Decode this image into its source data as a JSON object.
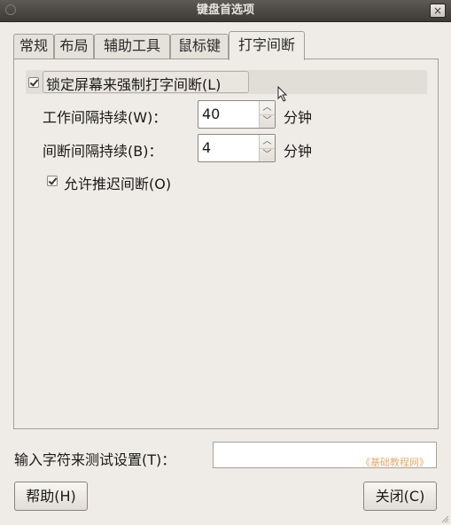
{
  "window": {
    "title": "键盘首选项",
    "close_glyph": "×"
  },
  "tabs": [
    {
      "label": "常规",
      "active": false
    },
    {
      "label": "布局",
      "active": false
    },
    {
      "label": "辅助工具",
      "active": false
    },
    {
      "label": "鼠标键",
      "active": false
    },
    {
      "label": "打字间断",
      "active": true
    }
  ],
  "typing_break": {
    "lock_screen": {
      "label": "锁定屏幕来强制打字间断(L)",
      "checked": true
    },
    "work_interval": {
      "label": "工作间隔持续(W)：",
      "value": "40",
      "unit": "分钟"
    },
    "break_interval": {
      "label": "间断间隔持续(B)：",
      "value": "4",
      "unit": "分钟"
    },
    "allow_postpone": {
      "label": "允许推迟间断(O)",
      "checked": true
    }
  },
  "test_field": {
    "label": "输入字符来测试设置(T)：",
    "value": "",
    "watermark": "《基础教程网》"
  },
  "buttons": {
    "help": "帮助(H)",
    "close": "关闭(C)"
  },
  "icons": {
    "window_menu": "window-menu-icon",
    "close": "close-icon",
    "spin_up": "chevron-up-icon",
    "spin_down": "chevron-down-icon",
    "checkbox": "checkmark-icon",
    "pointer": "mouse-pointer-icon"
  },
  "colors": {
    "titlebar": "#4a4743",
    "window_bg": "#efebe7",
    "watermark": "#e7a96b"
  }
}
